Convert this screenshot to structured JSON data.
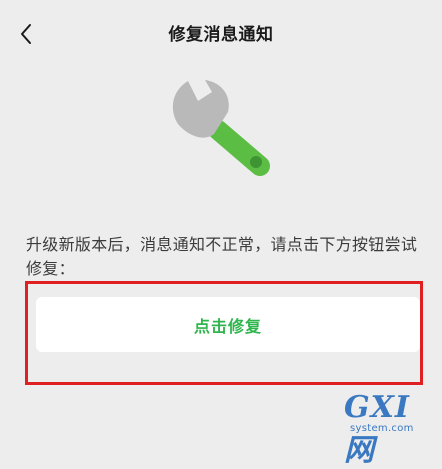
{
  "header": {
    "title": "修复消息通知",
    "back_icon": "chevron-left-icon"
  },
  "hero": {
    "icon": "wrench-icon",
    "colors": {
      "handle": "#5cbd45",
      "head": "#b9b9b9"
    }
  },
  "content": {
    "description": "升级新版本后，消息通知不正常，请点击下方按钮尝试修复：",
    "repair_button_label": "点击修复"
  },
  "watermark": {
    "main": "GXI网",
    "sub": "system.com"
  },
  "colors": {
    "background": "#ededed",
    "accent": "#2fb54d",
    "highlight": "#e02020"
  }
}
